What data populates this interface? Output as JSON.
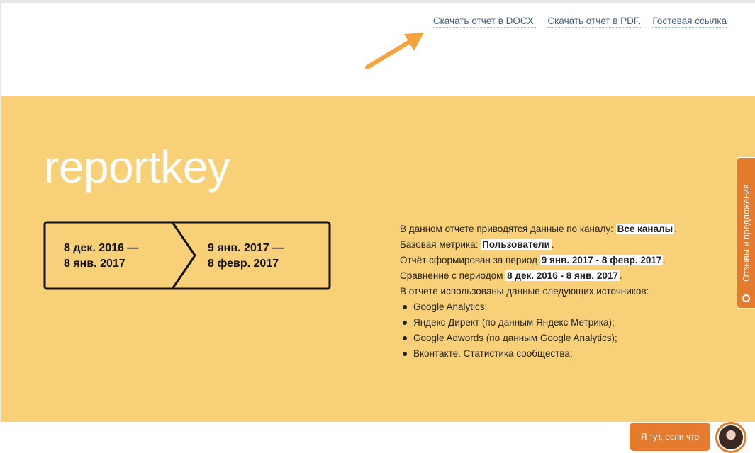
{
  "topnav": {
    "docx": "Скачать отчет в DOCX.",
    "pdf": "Скачать отчет в PDF.",
    "guest": "Гостевая ссылка"
  },
  "hero": {
    "brand": "reportkey",
    "period_current": {
      "line1": "8 дек. 2016 —",
      "line2": "8 янв. 2017"
    },
    "period_compare": {
      "line1": "9 янв. 2017 —",
      "line2": "8 февр. 2017"
    }
  },
  "info": {
    "line1_prefix": "В данном отчете приводятся данные по каналу:",
    "channel": "Все каналы",
    "line1_suffix": ".",
    "line2_prefix": "Базовая метрика:",
    "metric": "Пользователи",
    "line2_suffix": ".",
    "line3_prefix": "Отчёт сформирован за период",
    "period": "9 янв. 2017 - 8 февр. 2017",
    "line3_suffix": ".",
    "line4_prefix": "Сравнение с периодом",
    "compare_period": "8 дек. 2016 - 8 янв. 2017",
    "line4_suffix": ".",
    "sources_intro": "В отчете использованы данные следующих источников:",
    "sources": [
      "Google Analytics;",
      "Яндекс Директ (по данным Яндекс Метрика);",
      "Google Adwords (по данным Google Analytics);",
      "Вконтакте. Статистика сообщества;"
    ]
  },
  "feedback_tab": "Отзывы и предложения",
  "chat": {
    "bubble": "Я тут, если что"
  },
  "colors": {
    "hero_bg": "#f8d077",
    "accent": "#e57b2e",
    "link": "#3f5f86",
    "arrow": "#f5a33a"
  },
  "icons": {
    "arrow": "pointer-arrow-icon",
    "chevron": "chevron-divider-icon",
    "bullet": "bullet-dot-icon",
    "bulb": "lightbulb-icon",
    "avatar": "consultant-avatar"
  }
}
